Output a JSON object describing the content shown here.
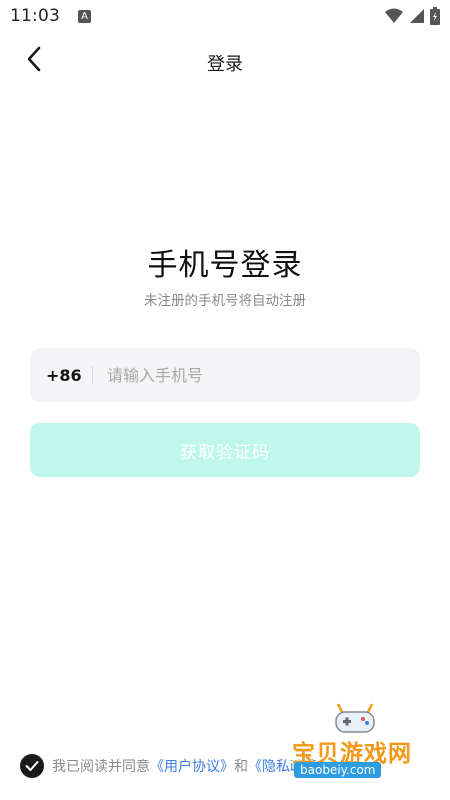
{
  "status_bar": {
    "time": "11:03",
    "notification_letter": "A"
  },
  "nav": {
    "title": "登录"
  },
  "main": {
    "heading": "手机号登录",
    "subheading": "未注册的手机号将自动注册",
    "country_code": "+86",
    "phone_placeholder": "请输入手机号",
    "phone_value": "",
    "code_button_label": "获取验证码"
  },
  "agreement": {
    "prefix": "我已阅读并同意",
    "user_agreement": "《用户协议》",
    "conjunction": "和",
    "privacy_policy": "《隐私政策》"
  },
  "watermark": {
    "name": "宝贝游戏网",
    "url": "baobeiy.com"
  },
  "colors": {
    "accent_disabled": "#bff8ea",
    "link": "#3b7de9",
    "watermark_orange": "#f29a17",
    "watermark_blue": "#2f9be0"
  },
  "icons": [
    "back-arrow-icon",
    "wifi-icon",
    "signal-icon",
    "battery-icon",
    "check-icon",
    "gamepad-icon"
  ]
}
